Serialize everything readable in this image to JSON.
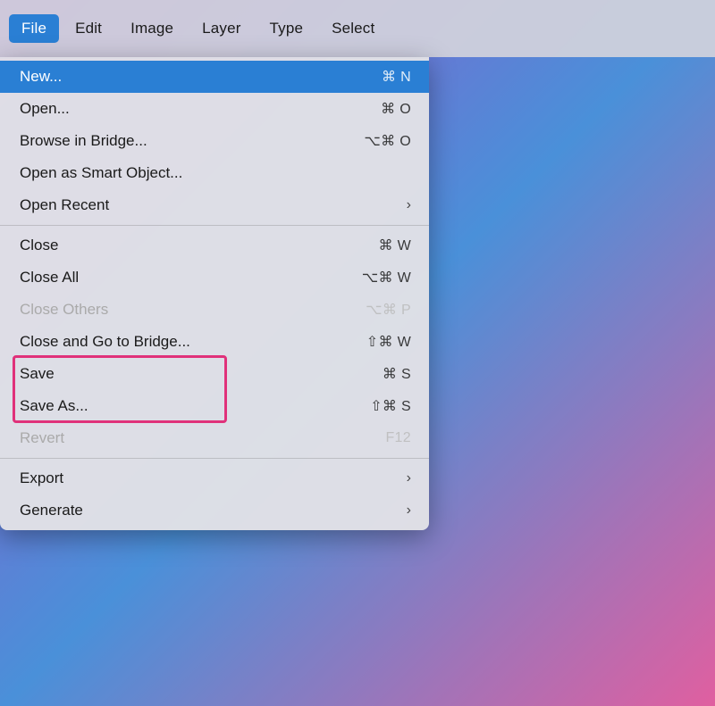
{
  "menubar": {
    "items": [
      {
        "label": "File",
        "id": "file",
        "active": true
      },
      {
        "label": "Edit",
        "id": "edit",
        "active": false
      },
      {
        "label": "Image",
        "id": "image",
        "active": false
      },
      {
        "label": "Layer",
        "id": "layer",
        "active": false
      },
      {
        "label": "Type",
        "id": "type",
        "active": false
      },
      {
        "label": "Select",
        "id": "select",
        "active": false
      }
    ]
  },
  "dropdown": {
    "items": [
      {
        "id": "new",
        "label": "New...",
        "shortcut": "⌘ N",
        "type": "item",
        "highlighted": true,
        "disabled": false
      },
      {
        "id": "open",
        "label": "Open...",
        "shortcut": "⌘ O",
        "type": "item",
        "highlighted": false,
        "disabled": false
      },
      {
        "id": "browse",
        "label": "Browse in Bridge...",
        "shortcut": "⌥⌘ O",
        "type": "item",
        "highlighted": false,
        "disabled": false
      },
      {
        "id": "open-smart",
        "label": "Open as Smart Object...",
        "shortcut": "",
        "type": "item",
        "highlighted": false,
        "disabled": false
      },
      {
        "id": "open-recent",
        "label": "Open Recent",
        "shortcut": "",
        "type": "submenu",
        "highlighted": false,
        "disabled": false
      },
      {
        "id": "sep1",
        "type": "separator"
      },
      {
        "id": "close",
        "label": "Close",
        "shortcut": "⌘ W",
        "type": "item",
        "highlighted": false,
        "disabled": false
      },
      {
        "id": "close-all",
        "label": "Close All",
        "shortcut": "⌥⌘ W",
        "type": "item",
        "highlighted": false,
        "disabled": false
      },
      {
        "id": "close-others",
        "label": "Close Others",
        "shortcut": "⌥⌘ P",
        "type": "item",
        "highlighted": false,
        "disabled": true
      },
      {
        "id": "close-bridge",
        "label": "Close and Go to Bridge...",
        "shortcut": "⇧⌘ W",
        "type": "item",
        "highlighted": false,
        "disabled": false
      },
      {
        "id": "save",
        "label": "Save",
        "shortcut": "⌘ S",
        "type": "item",
        "highlighted": false,
        "disabled": false
      },
      {
        "id": "save-as",
        "label": "Save As...",
        "shortcut": "⇧⌘ S",
        "type": "item",
        "highlighted": false,
        "disabled": false
      },
      {
        "id": "revert",
        "label": "Revert",
        "shortcut": "F12",
        "type": "item",
        "highlighted": false,
        "disabled": true
      },
      {
        "id": "sep2",
        "type": "separator"
      },
      {
        "id": "export",
        "label": "Export",
        "shortcut": "",
        "type": "submenu",
        "highlighted": false,
        "disabled": false
      },
      {
        "id": "generate",
        "label": "Generate",
        "shortcut": "",
        "type": "submenu",
        "highlighted": false,
        "disabled": false
      }
    ]
  },
  "highlight_box": {
    "label": "save-highlight-box"
  }
}
